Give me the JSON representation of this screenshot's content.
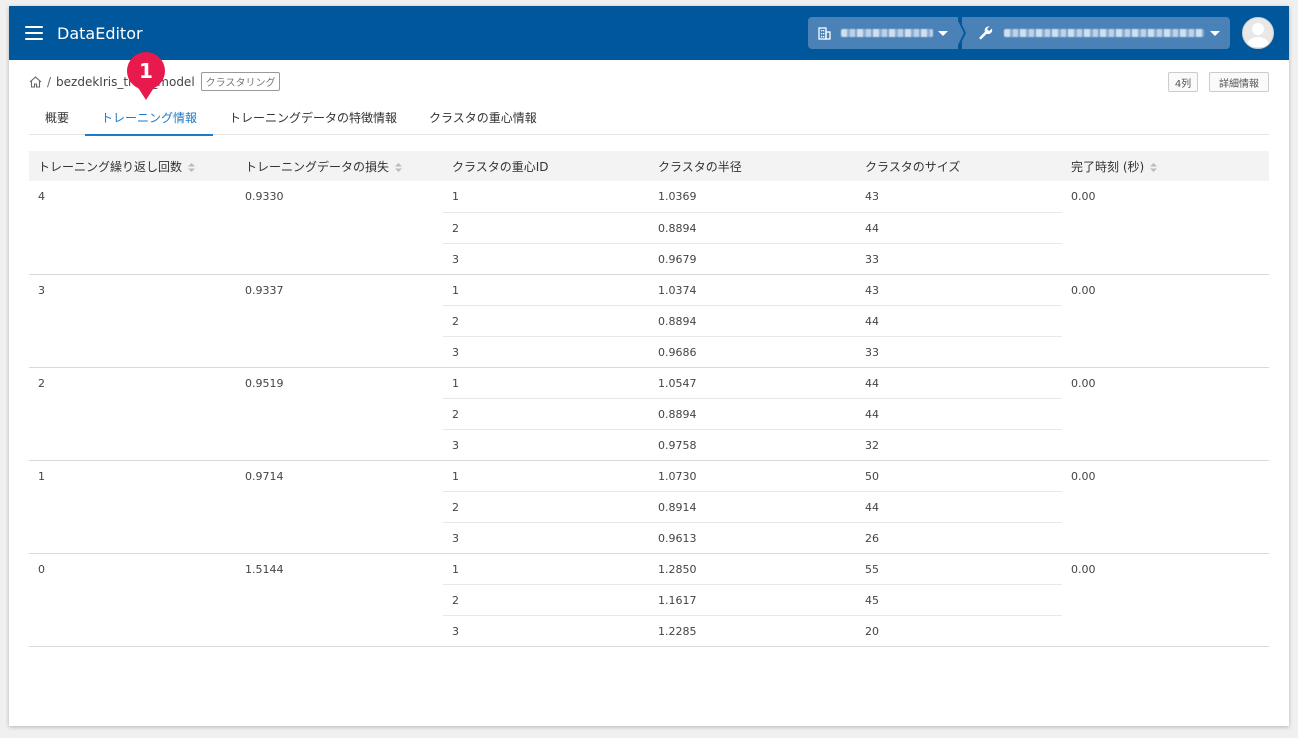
{
  "app": {
    "title": "DataEditor"
  },
  "breadcrumb": {
    "model_name": "bezdekIris_train_model",
    "model_tag": "クラスタリング"
  },
  "top_buttons": {
    "columns_label": "4列",
    "details_label": "詳細情報"
  },
  "tabs": [
    {
      "label": "概要"
    },
    {
      "label": "トレーニング情報"
    },
    {
      "label": "トレーニングデータの特徴情報"
    },
    {
      "label": "クラスタの重心情報"
    }
  ],
  "marker": {
    "label": "1"
  },
  "table": {
    "headers": [
      "トレーニング繰り返し回数",
      "トレーニングデータの損失",
      "クラスタの重心ID",
      "クラスタの半径",
      "クラスタのサイズ",
      "完了時刻 (秒)"
    ],
    "groups": [
      {
        "iteration": "4",
        "loss": "0.9330",
        "time": "0.00",
        "clusters": [
          {
            "id": "1",
            "radius": "1.0369",
            "size": "43"
          },
          {
            "id": "2",
            "radius": "0.8894",
            "size": "44"
          },
          {
            "id": "3",
            "radius": "0.9679",
            "size": "33"
          }
        ]
      },
      {
        "iteration": "3",
        "loss": "0.9337",
        "time": "0.00",
        "clusters": [
          {
            "id": "1",
            "radius": "1.0374",
            "size": "43"
          },
          {
            "id": "2",
            "radius": "0.8894",
            "size": "44"
          },
          {
            "id": "3",
            "radius": "0.9686",
            "size": "33"
          }
        ]
      },
      {
        "iteration": "2",
        "loss": "0.9519",
        "time": "0.00",
        "clusters": [
          {
            "id": "1",
            "radius": "1.0547",
            "size": "44"
          },
          {
            "id": "2",
            "radius": "0.8894",
            "size": "44"
          },
          {
            "id": "3",
            "radius": "0.9758",
            "size": "32"
          }
        ]
      },
      {
        "iteration": "1",
        "loss": "0.9714",
        "time": "0.00",
        "clusters": [
          {
            "id": "1",
            "radius": "1.0730",
            "size": "50"
          },
          {
            "id": "2",
            "radius": "0.8914",
            "size": "44"
          },
          {
            "id": "3",
            "radius": "0.9613",
            "size": "26"
          }
        ]
      },
      {
        "iteration": "0",
        "loss": "1.5144",
        "time": "0.00",
        "clusters": [
          {
            "id": "1",
            "radius": "1.2850",
            "size": "55"
          },
          {
            "id": "2",
            "radius": "1.1617",
            "size": "45"
          },
          {
            "id": "3",
            "radius": "1.2285",
            "size": "20"
          }
        ]
      }
    ]
  }
}
